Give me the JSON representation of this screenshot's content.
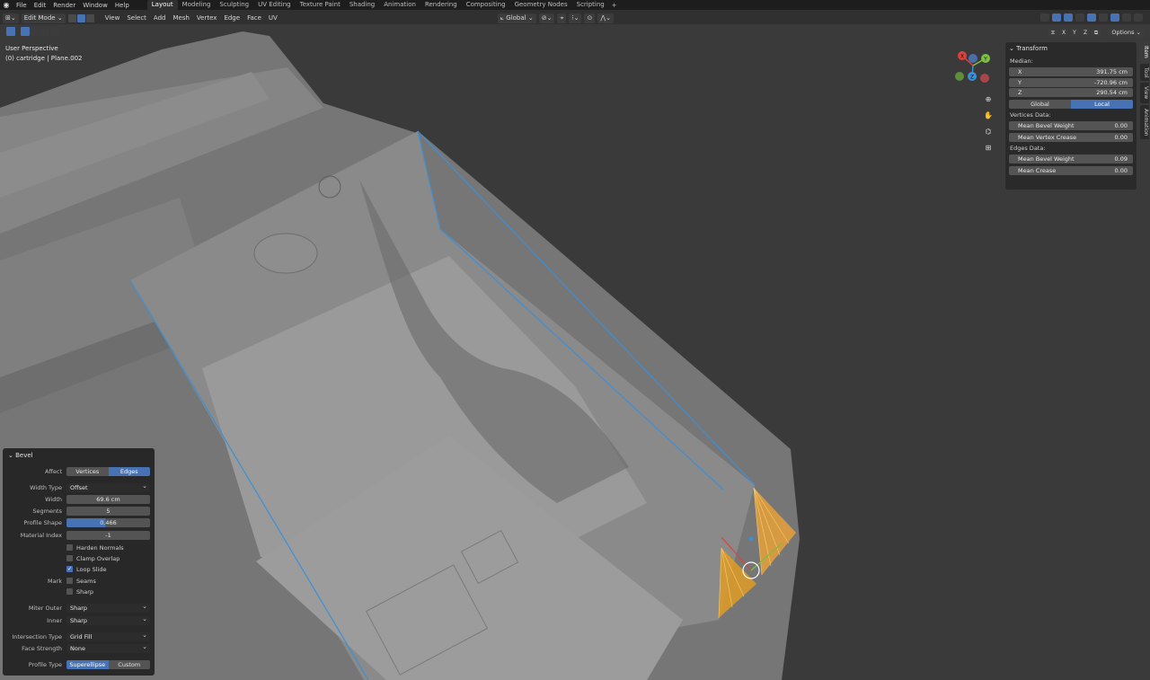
{
  "menubar": {
    "items": [
      "File",
      "Edit",
      "Render",
      "Window",
      "Help"
    ],
    "workspaces": [
      "Layout",
      "Modeling",
      "Sculpting",
      "UV Editing",
      "Texture Paint",
      "Shading",
      "Animation",
      "Rendering",
      "Compositing",
      "Geometry Nodes",
      "Scripting"
    ],
    "active_workspace": "Layout",
    "add_tab": "+"
  },
  "header": {
    "mode": "Edit Mode",
    "menus": [
      "View",
      "Select",
      "Add",
      "Mesh",
      "Vertex",
      "Edge",
      "Face",
      "UV"
    ],
    "orientation": "Global"
  },
  "viewport": {
    "view_name": "User Perspective",
    "object_info": "(0) cartridge | Plane.002",
    "gizmo": {
      "x": "X",
      "y": "Y",
      "z": "Z"
    },
    "mirror_axes": [
      "X",
      "Y",
      "Z"
    ],
    "options_label": "Options"
  },
  "npanel": {
    "title": "Transform",
    "median_label": "Median:",
    "x_label": "X",
    "x_value": "391.75 cm",
    "y_label": "Y",
    "y_value": "-720.96 cm",
    "z_label": "Z",
    "z_value": "290.54 cm",
    "space_global": "Global",
    "space_local": "Local",
    "vertices_label": "Vertices Data:",
    "v_bevel_label": "Mean Bevel Weight",
    "v_bevel_value": "0.00",
    "v_crease_label": "Mean Vertex Crease",
    "v_crease_value": "0.00",
    "edges_label": "Edges Data:",
    "e_bevel_label": "Mean Bevel Weight",
    "e_bevel_value": "0.09",
    "e_crease_label": "Mean Crease",
    "e_crease_value": "0.00",
    "tabs": [
      "Item",
      "Tool",
      "View",
      "Animation"
    ]
  },
  "bevel": {
    "title": "Bevel",
    "affect_label": "Affect",
    "affect_vertices": "Vertices",
    "affect_edges": "Edges",
    "width_type_label": "Width Type",
    "width_type_value": "Offset",
    "width_label": "Width",
    "width_value": "69.6 cm",
    "segments_label": "Segments",
    "segments_value": "5",
    "profile_shape_label": "Profile Shape",
    "profile_shape_value": "0.466",
    "profile_shape_fraction": 0.466,
    "material_index_label": "Material Index",
    "material_index_value": "-1",
    "harden_normals": "Harden Normals",
    "clamp_overlap": "Clamp Overlap",
    "loop_slide": "Loop Slide",
    "mark_label": "Mark",
    "seams": "Seams",
    "sharp": "Sharp",
    "miter_outer_label": "Miter Outer",
    "miter_outer_value": "Sharp",
    "inner_label": "Inner",
    "inner_value": "Sharp",
    "intersection_type_label": "Intersection Type",
    "intersection_type_value": "Grid Fill",
    "face_strength_label": "Face Strength",
    "face_strength_value": "None",
    "profile_type_label": "Profile Type",
    "profile_superellipse": "Superellipse",
    "profile_custom": "Custom"
  },
  "colors": {
    "accent": "#4772b3",
    "selection_edge": "#3d8fd6",
    "bevel_face": "#e8a23a"
  }
}
